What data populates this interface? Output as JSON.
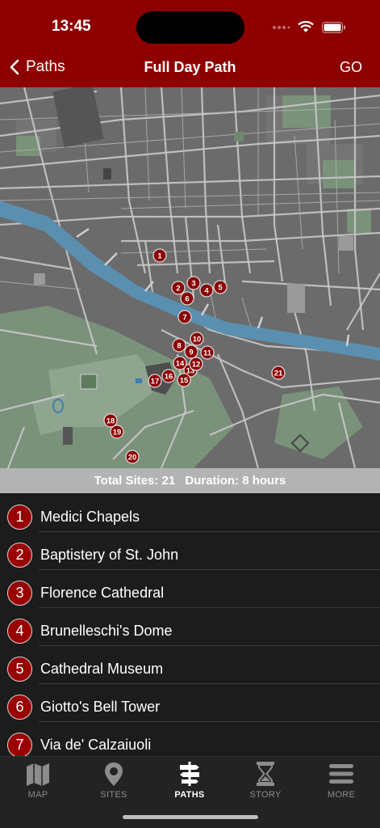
{
  "status": {
    "time": "13:45",
    "icons": [
      "signal-dots-icon",
      "wifi-icon",
      "battery-icon"
    ]
  },
  "nav": {
    "back_label": "Paths",
    "title": "Full Day Path",
    "go_label": "GO"
  },
  "summary": {
    "sites_label": "Total Sites: 21",
    "duration_label": "Duration: 8 hours"
  },
  "map": {
    "markers": [
      "1",
      "2",
      "3",
      "4",
      "5",
      "6",
      "7",
      "8",
      "9",
      "10",
      "11",
      "13",
      "12",
      "14",
      "15",
      "16",
      "17",
      "18",
      "19",
      "20",
      "21"
    ]
  },
  "sites": [
    {
      "number": "1",
      "name": "Medici Chapels"
    },
    {
      "number": "2",
      "name": "Baptistery of St. John"
    },
    {
      "number": "3",
      "name": "Florence Cathedral"
    },
    {
      "number": "4",
      "name": "Brunelleschi's Dome"
    },
    {
      "number": "5",
      "name": "Cathedral Museum"
    },
    {
      "number": "6",
      "name": "Giotto's Bell Tower"
    },
    {
      "number": "7",
      "name": "Via de' Calzaiuoli"
    }
  ],
  "tabs": [
    {
      "label": "MAP",
      "icon": "map-icon",
      "active": false
    },
    {
      "label": "SITES",
      "icon": "location-pin-icon",
      "active": false
    },
    {
      "label": "PATHS",
      "icon": "signpost-icon",
      "active": true
    },
    {
      "label": "STORY",
      "icon": "hourglass-icon",
      "active": false
    },
    {
      "label": "MORE",
      "icon": "menu-icon",
      "active": false
    }
  ],
  "colors": {
    "brand": "#8e0000",
    "marker": "#8b0000",
    "river": "#5a8fb0",
    "park": "#7f9a7f"
  }
}
